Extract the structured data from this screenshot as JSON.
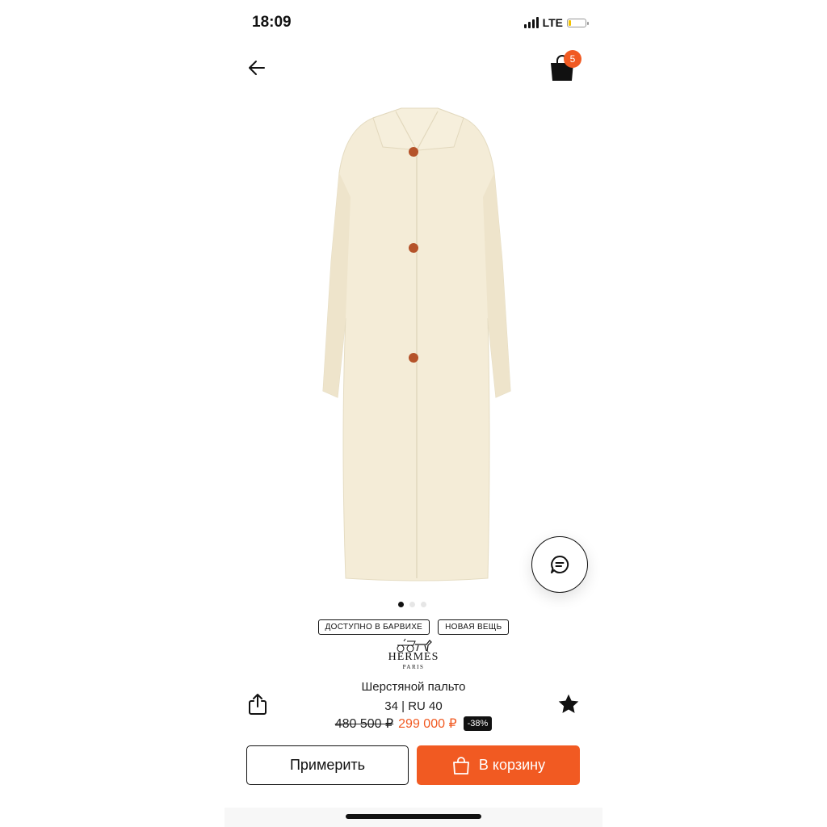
{
  "status_bar": {
    "time": "18:09",
    "network": "LTE",
    "battery_level_percent": 10
  },
  "header": {
    "back_icon": "arrow-left-icon",
    "cart_icon": "shopping-bag-icon",
    "cart_count": "5"
  },
  "gallery": {
    "image_count": 3,
    "active_index": 0
  },
  "tags": [
    "ДОСТУПНО В БАРВИХЕ",
    "НОВАЯ ВЕЩЬ"
  ],
  "brand": {
    "name": "HERMÈS",
    "city": "PARIS"
  },
  "product": {
    "name": "Шерстяной пальто",
    "size": "34 | RU 40",
    "old_price": "480 500 ₽",
    "new_price": "299 000 ₽",
    "discount": "-38%"
  },
  "actions": {
    "try_on_label": "Примерить",
    "add_to_cart_label": "В корзину",
    "share_icon": "share-icon",
    "favorite_icon": "star-icon",
    "chat_icon": "chat-icon"
  },
  "colors": {
    "accent": "#f15a22",
    "text": "#111111",
    "coat": "#f4ecd7",
    "buttons": "#b5532a"
  }
}
